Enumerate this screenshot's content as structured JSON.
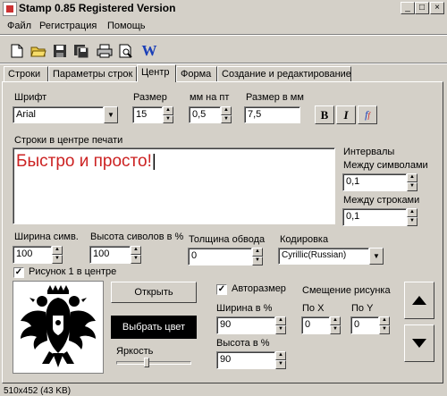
{
  "window": {
    "title": "Stamp 0.85 Registered Version"
  },
  "menu": [
    "Файл",
    "Регистрация",
    "Помощь"
  ],
  "toolbar_icons": [
    "new-file-icon",
    "open-folder-icon",
    "save-icon",
    "save-as-icon",
    "print-icon",
    "print-preview-icon",
    "word-icon"
  ],
  "toolbar_word_glyph": "W",
  "tabs": [
    "Строки",
    "Параметры строк",
    "Центр",
    "Форма",
    "Создание и редактирование"
  ],
  "active_tab": "Центр",
  "font": {
    "label": "Шрифт",
    "value": "Arial"
  },
  "size": {
    "label": "Размер",
    "value": "15"
  },
  "mm_per_pt": {
    "label": "мм на пт",
    "value": "0,5"
  },
  "size_mm": {
    "label": "Размер в мм",
    "value": "7,5"
  },
  "style_buttons": {
    "bold": "B",
    "italic": "I",
    "flip": "f"
  },
  "center_text": {
    "label": "Строки в центре печати",
    "value": "Быстро и просто!"
  },
  "intervals": {
    "label": "Интервалы",
    "between_chars_label": "Между символами",
    "between_chars": "0,1",
    "between_lines_label": "Между строками",
    "between_lines": "0,1"
  },
  "char_width": {
    "label": "Ширина симв.",
    "value": "100"
  },
  "char_height": {
    "label": "Высота сиволов в %",
    "value": "100"
  },
  "stroke": {
    "label": "Толщина обвода",
    "value": "0"
  },
  "encoding": {
    "label": "Кодировка",
    "value": "Cyrillic(Russian)"
  },
  "picture": {
    "label": "Рисунок 1 в центре",
    "checked": true
  },
  "buttons": {
    "open": "Открыть",
    "color": "Выбрать цвет"
  },
  "brightness": {
    "label": "Яркость",
    "level": 0.4
  },
  "autosize": {
    "label": "Авторазмер",
    "checked": true
  },
  "shift": {
    "label": "Смещение рисунка",
    "x_label": "По X",
    "x": "0",
    "y_label": "По Y",
    "y": "0"
  },
  "pic_width": {
    "label": "Ширина в %",
    "value": "90"
  },
  "pic_height": {
    "label": "Высота в %",
    "value": "90"
  },
  "status": "510x452 (43 KB)",
  "colors": {
    "text_red": "#cc2222",
    "face": "#d4d0c8"
  }
}
